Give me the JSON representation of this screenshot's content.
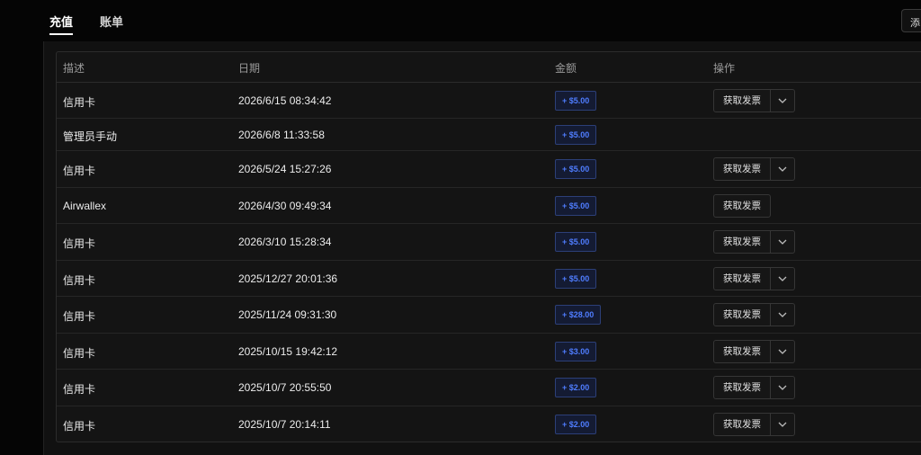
{
  "tabs": [
    {
      "label": "充值",
      "active": true
    },
    {
      "label": "账单",
      "active": false
    }
  ],
  "add_button_label": "添",
  "columns": {
    "description": "描述",
    "date": "日期",
    "amount": "金额",
    "actions": "操作"
  },
  "rows": [
    {
      "description": "信用卡",
      "date": "2026/6/15 08:34:42",
      "amount": "+ $5.00",
      "invoice_label": "获取发票",
      "has_invoice": true,
      "has_dropdown": true
    },
    {
      "description": "管理员手动",
      "date": "2026/6/8 11:33:58",
      "amount": "+ $5.00",
      "invoice_label": "",
      "has_invoice": false,
      "has_dropdown": false
    },
    {
      "description": "信用卡",
      "date": "2026/5/24 15:27:26",
      "amount": "+ $5.00",
      "invoice_label": "获取发票",
      "has_invoice": true,
      "has_dropdown": true
    },
    {
      "description": "Airwallex",
      "date": "2026/4/30 09:49:34",
      "amount": "+ $5.00",
      "invoice_label": "获取发票",
      "has_invoice": true,
      "has_dropdown": false
    },
    {
      "description": "信用卡",
      "date": "2026/3/10 15:28:34",
      "amount": "+ $5.00",
      "invoice_label": "获取发票",
      "has_invoice": true,
      "has_dropdown": true
    },
    {
      "description": "信用卡",
      "date": "2025/12/27 20:01:36",
      "amount": "+ $5.00",
      "invoice_label": "获取发票",
      "has_invoice": true,
      "has_dropdown": true
    },
    {
      "description": "信用卡",
      "date": "2025/11/24 09:31:30",
      "amount": "+ $28.00",
      "invoice_label": "获取发票",
      "has_invoice": true,
      "has_dropdown": true
    },
    {
      "description": "信用卡",
      "date": "2025/10/15 19:42:12",
      "amount": "+ $3.00",
      "invoice_label": "获取发票",
      "has_invoice": true,
      "has_dropdown": true
    },
    {
      "description": "信用卡",
      "date": "2025/10/7 20:55:50",
      "amount": "+ $2.00",
      "invoice_label": "获取发票",
      "has_invoice": true,
      "has_dropdown": true
    },
    {
      "description": "信用卡",
      "date": "2025/10/7 20:14:11",
      "amount": "+ $2.00",
      "invoice_label": "获取发票",
      "has_invoice": true,
      "has_dropdown": true
    }
  ],
  "colors": {
    "background": "#050505",
    "panel": "#111111",
    "amount_text": "#4f7dff",
    "amount_border": "#2c3f78"
  },
  "icons": {
    "dropdown": "chevron-down-icon"
  }
}
